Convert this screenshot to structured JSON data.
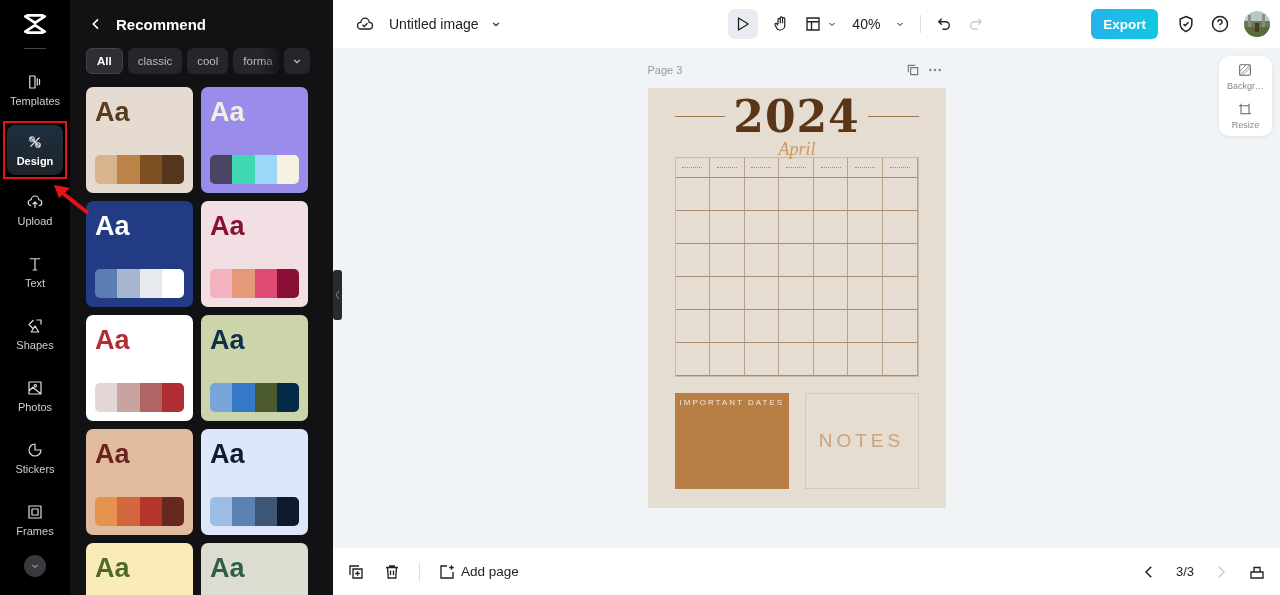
{
  "nav": {
    "items": [
      {
        "label": "Templates",
        "selected": false,
        "highlighted": false
      },
      {
        "label": "Design",
        "selected": true,
        "highlighted": true
      },
      {
        "label": "Upload",
        "selected": false,
        "highlighted": false
      },
      {
        "label": "Text",
        "selected": false,
        "highlighted": false
      },
      {
        "label": "Shapes",
        "selected": false,
        "highlighted": false
      },
      {
        "label": "Photos",
        "selected": false,
        "highlighted": false
      },
      {
        "label": "Stickers",
        "selected": false,
        "highlighted": false
      },
      {
        "label": "Frames",
        "selected": false,
        "highlighted": false
      }
    ]
  },
  "panel": {
    "title": "Recommend",
    "filters": [
      {
        "label": "All",
        "selected": true
      },
      {
        "label": "classic",
        "selected": false
      },
      {
        "label": "cool",
        "selected": false
      },
      {
        "label": "forma",
        "selected": false
      }
    ],
    "themes": [
      {
        "color": "#e6dbd0",
        "sample": {
          "label": "Aa",
          "color": "#5a3a1e"
        },
        "swatches": [
          {
            "color": "#d8b48c"
          },
          {
            "color": "#bc8448"
          },
          {
            "color": "#7f4f24"
          },
          {
            "color": "#55351c"
          }
        ]
      },
      {
        "color": "#9a8ceb",
        "sample": {
          "label": "Aa",
          "color": "#f5eedc"
        },
        "swatches": [
          {
            "color": "#4a4563"
          },
          {
            "color": "#40d8b0"
          },
          {
            "color": "#9adaf8"
          },
          {
            "color": "#f5f0e0"
          }
        ]
      },
      {
        "color": "#233b85",
        "sample": {
          "label": "Aa",
          "color": "#ffffff"
        },
        "swatches": [
          {
            "color": "#5b7db3"
          },
          {
            "color": "#a5b5cd"
          },
          {
            "color": "#e6e9ee"
          },
          {
            "color": "#ffffff"
          }
        ]
      },
      {
        "color": "#f2dfe3",
        "sample": {
          "label": "Aa",
          "color": "#8a0f35"
        },
        "swatches": [
          {
            "color": "#f4b2c0"
          },
          {
            "color": "#e5987a"
          },
          {
            "color": "#de4a72"
          },
          {
            "color": "#8a0f35"
          }
        ]
      },
      {
        "color": "#ffffff",
        "sample": {
          "label": "Aa",
          "color": "#b02e33"
        },
        "swatches": [
          {
            "color": "#e3d6d6"
          },
          {
            "color": "#c9a2a2"
          },
          {
            "color": "#b06565"
          },
          {
            "color": "#b02e33"
          }
        ]
      },
      {
        "color": "#ccd5aa",
        "sample": {
          "label": "Aa",
          "color": "#0f2f4a"
        },
        "swatches": [
          {
            "color": "#78a6dc"
          },
          {
            "color": "#3679c8"
          },
          {
            "color": "#4a5a2c"
          },
          {
            "color": "#052a48"
          }
        ]
      },
      {
        "color": "#e0bb9d",
        "sample": {
          "label": "Aa",
          "color": "#6a221e"
        },
        "swatches": [
          {
            "color": "#e5924f"
          },
          {
            "color": "#d2663e"
          },
          {
            "color": "#b53528"
          },
          {
            "color": "#682822"
          }
        ]
      },
      {
        "color": "#dde7fc",
        "sample": {
          "label": "Aa",
          "color": "#0f1d33"
        },
        "swatches": [
          {
            "color": "#9dbde2"
          },
          {
            "color": "#5c82b2"
          },
          {
            "color": "#3c5778"
          },
          {
            "color": "#0d1a2e"
          }
        ]
      },
      {
        "color": "#faecb8",
        "sample": {
          "label": "Aa",
          "color": "#4e6a2a"
        }
      },
      {
        "color": "#dcdcd0",
        "sample": {
          "label": "Aa",
          "color": "#2f5f4a"
        }
      }
    ]
  },
  "topbar": {
    "file_name": "Untitled image",
    "zoom": "40%",
    "export": "Export",
    "redo_disabled": true
  },
  "canvas": {
    "page_label": "Page 3",
    "calendar": {
      "year": "2024",
      "month": "April",
      "important": "IMPORTANT DATES",
      "notes": "NOTES"
    }
  },
  "side_tools": [
    {
      "label": "Backgr…"
    },
    {
      "label": "Resize"
    }
  ],
  "bottombar": {
    "add_page": "Add page",
    "page_count": "3/3",
    "prev_disabled": false,
    "next_disabled": true
  }
}
